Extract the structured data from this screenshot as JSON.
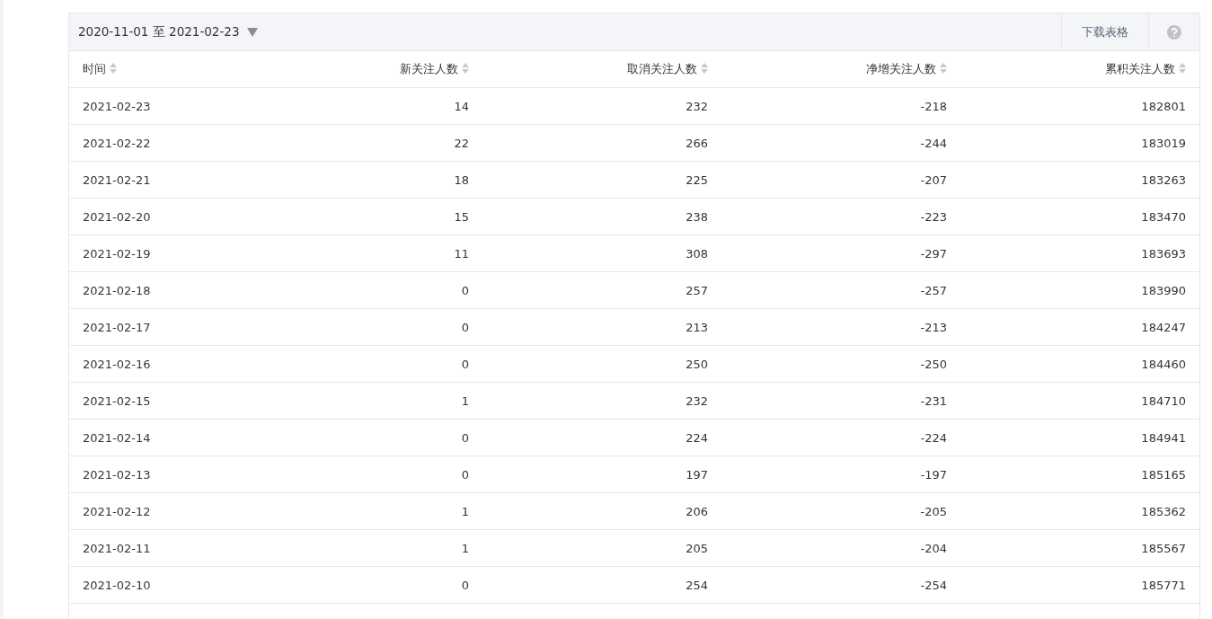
{
  "toolbar": {
    "date_range": "2020-11-01 至 2021-02-23",
    "download_button": "下载表格"
  },
  "table": {
    "columns": [
      "时间",
      "新关注人数",
      "取消关注人数",
      "净增关注人数",
      "累积关注人数"
    ],
    "rows": [
      [
        "2021-02-23",
        "14",
        "232",
        "-218",
        "182801"
      ],
      [
        "2021-02-22",
        "22",
        "266",
        "-244",
        "183019"
      ],
      [
        "2021-02-21",
        "18",
        "225",
        "-207",
        "183263"
      ],
      [
        "2021-02-20",
        "15",
        "238",
        "-223",
        "183470"
      ],
      [
        "2021-02-19",
        "11",
        "308",
        "-297",
        "183693"
      ],
      [
        "2021-02-18",
        "0",
        "257",
        "-257",
        "183990"
      ],
      [
        "2021-02-17",
        "0",
        "213",
        "-213",
        "184247"
      ],
      [
        "2021-02-16",
        "0",
        "250",
        "-250",
        "184460"
      ],
      [
        "2021-02-15",
        "1",
        "232",
        "-231",
        "184710"
      ],
      [
        "2021-02-14",
        "0",
        "224",
        "-224",
        "184941"
      ],
      [
        "2021-02-13",
        "0",
        "197",
        "-197",
        "185165"
      ],
      [
        "2021-02-12",
        "1",
        "206",
        "-205",
        "185362"
      ],
      [
        "2021-02-11",
        "1",
        "205",
        "-204",
        "185567"
      ],
      [
        "2021-02-10",
        "0",
        "254",
        "-254",
        "185771"
      ]
    ]
  }
}
